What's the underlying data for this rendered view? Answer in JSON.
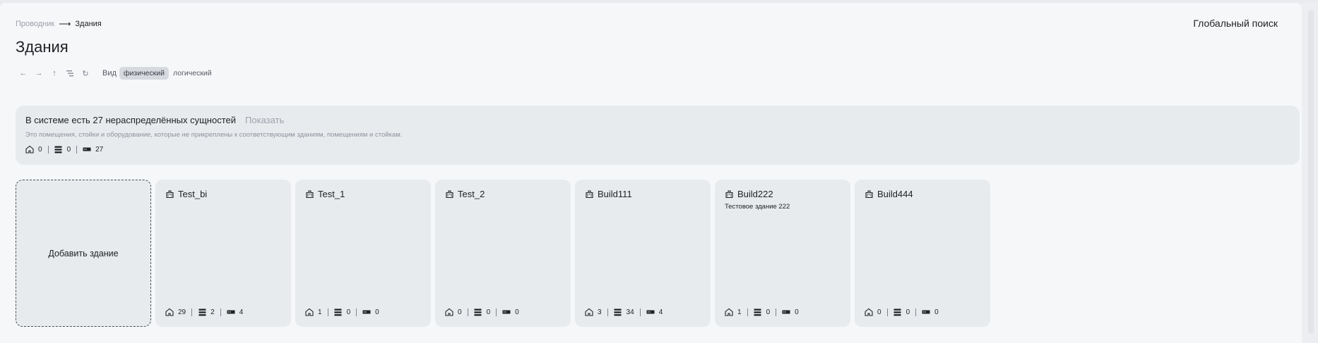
{
  "breadcrumb": {
    "parent": "Проводник",
    "arrow": "⟶",
    "current": "Здания"
  },
  "header": {
    "global_search": "Глобальный поиск",
    "title": "Здания"
  },
  "toolbar": {
    "back_icon": "←",
    "forward_icon": "→",
    "up_icon": "↑",
    "tree_icon": "⸬",
    "refresh_icon": "↻",
    "view_label": "Вид",
    "view_physical": "физический",
    "view_logical": "логический"
  },
  "banner": {
    "title": "В системе есть 27 нераспределённых сущностей",
    "show": "Показать",
    "description": "Это помещения, стойки и оборудование, которые не прикреплены к соответствующим зданиям, помещениям и стойкам.",
    "rooms": "0",
    "racks": "0",
    "devices": "27"
  },
  "add_card": {
    "label": "Добавить здание"
  },
  "buildings": [
    {
      "name": "Test_bi",
      "description": "",
      "rooms": "29",
      "racks": "2",
      "devices": "4"
    },
    {
      "name": "Test_1",
      "description": "",
      "rooms": "1",
      "racks": "0",
      "devices": "0"
    },
    {
      "name": "Test_2",
      "description": "",
      "rooms": "0",
      "racks": "0",
      "devices": "0"
    },
    {
      "name": "Build111",
      "description": "",
      "rooms": "3",
      "racks": "34",
      "devices": "4"
    },
    {
      "name": "Build222",
      "description": "Тестовое здание 222",
      "rooms": "1",
      "racks": "0",
      "devices": "0"
    },
    {
      "name": "Build444",
      "description": "",
      "rooms": "0",
      "racks": "0",
      "devices": "0"
    }
  ],
  "icons": {
    "building": "building-icon",
    "room": "room-icon",
    "rack": "rack-icon",
    "device": "device-icon"
  },
  "colors": {
    "background": "#f6f7f9",
    "card": "#e8ebee",
    "text": "#202226",
    "muted": "#9a9ea6",
    "active_segment": "#d6d9de"
  }
}
